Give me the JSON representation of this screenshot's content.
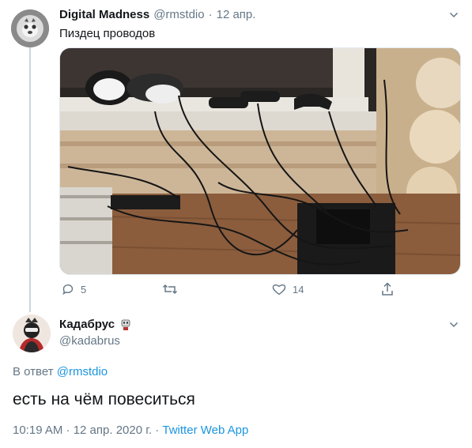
{
  "tweet1": {
    "display_name": "Digital Madness",
    "handle": "@rmstdio",
    "separator": "·",
    "date": "12 апр.",
    "text": "Пиздец проводов",
    "reply_count": "5",
    "like_count": "14"
  },
  "tweet2": {
    "display_name": "Кадабрус",
    "handle": "@kadabrus",
    "reply_prefix": "В ответ",
    "reply_to": "@rmstdio",
    "text": "есть на чём повеситься",
    "meta_time": "10:19 AM · 12 апр. 2020 г. ·",
    "meta_source": "Twitter Web App"
  },
  "colors": {
    "text": "#14171a",
    "muted": "#657786",
    "link": "#1b95e0",
    "thread_line": "#ccd6dd",
    "border": "#e1e8ed"
  }
}
